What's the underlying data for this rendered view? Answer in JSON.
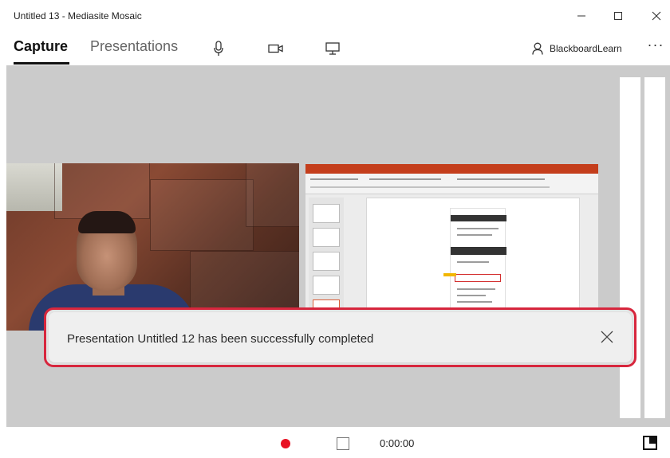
{
  "window": {
    "title": "Untitled 13 - Mediasite Mosaic",
    "controls": {
      "minimize": "minimize-icon",
      "maximize": "maximize-icon",
      "close": "close-icon"
    }
  },
  "nav": {
    "tabs": [
      {
        "label": "Capture",
        "active": true
      },
      {
        "label": "Presentations",
        "active": false
      }
    ],
    "icons": [
      "microphone-icon",
      "camera-icon",
      "screen-icon"
    ],
    "user": "BlackboardLearn",
    "more": "···"
  },
  "notification": {
    "message": "Presentation Untitled 12 has been successfully completed"
  },
  "controls": {
    "timer": "0:00:00",
    "record_color": "#e81123"
  },
  "colors": {
    "highlight": "#d7263d",
    "background": "#cbcbcb"
  }
}
